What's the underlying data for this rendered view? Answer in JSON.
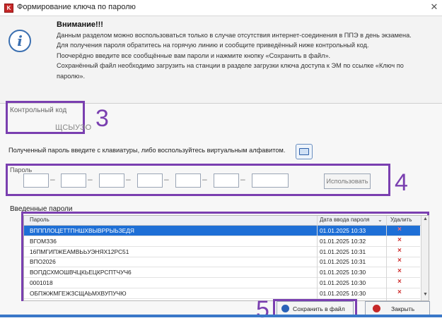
{
  "window": {
    "title": "Формирование ключа по паролю",
    "app_icon": "app-icon",
    "close_icon": "close-icon"
  },
  "notice": {
    "icon": "info-icon",
    "title": "Внимание!!!",
    "lines": [
      "Данным разделом можно воспользоваться только в случае отсутствия интернет-соединения в ППЭ в день экзамена.",
      "Для получения пароля обратитесь на горячую линию и сообщите приведённый ниже контрольный код.",
      "Поочерёдно введите все сообщённые вам пароли и нажмите кнопку «Сохранить в файл».",
      "Сохранённый файл необходимо загрузить на станции в разделе загрузки ключа доступа к ЭМ по ссылке «Ключ по",
      "паролю»."
    ]
  },
  "control_code": {
    "label": "Контрольный код",
    "value": "ЩСЫУЭО"
  },
  "instruction": "Полученный пароль введите с клавиатуры, либо воспользуйтесь виртуальным алфавитом.",
  "password": {
    "label": "Пароль",
    "use_button": "Использовать",
    "fields_count": 7
  },
  "entered": {
    "label": "Введенные пароли",
    "columns": {
      "password": "Пароль",
      "date": "Дата ввода пароля",
      "delete": "Удалить"
    },
    "rows": [
      {
        "password": "ВПППЛОЦЕТТПНШХВЫВРРЫЬЗЕДЯ",
        "date": "01.01.2025 10:33",
        "selected": true
      },
      {
        "password": "ВГОМЗЗ6",
        "date": "01.01.2025 10:32",
        "selected": false
      },
      {
        "password": "16ПМГИПЖЕАМВЬЬУЭНЯХ12РС51",
        "date": "01.01.2025 10:31",
        "selected": false
      },
      {
        "password": "ВПО2026",
        "date": "01.01.2025 10:31",
        "selected": false
      },
      {
        "password": "ВОПДСХМОШВЧЦКЬЕЦКРСПТЧУЧ6",
        "date": "01.01.2025 10:30",
        "selected": false
      },
      {
        "password": "0001018",
        "date": "01.01.2025 10:30",
        "selected": false
      },
      {
        "password": "ОБПЖЖМГЕЖЗСЩАЬМХВУПУЧЮ",
        "date": "01.01.2025 10:30",
        "selected": false
      }
    ],
    "delete_glyph": "×"
  },
  "buttons": {
    "save": "Сохранить в файл",
    "close": "Закрыть"
  },
  "markers": {
    "control_code": "3",
    "password_row": "4",
    "save_button": "5"
  },
  "colors": {
    "highlight": "#7a3fb0",
    "selection": "#1e6fd6",
    "delete": "#d03030"
  }
}
